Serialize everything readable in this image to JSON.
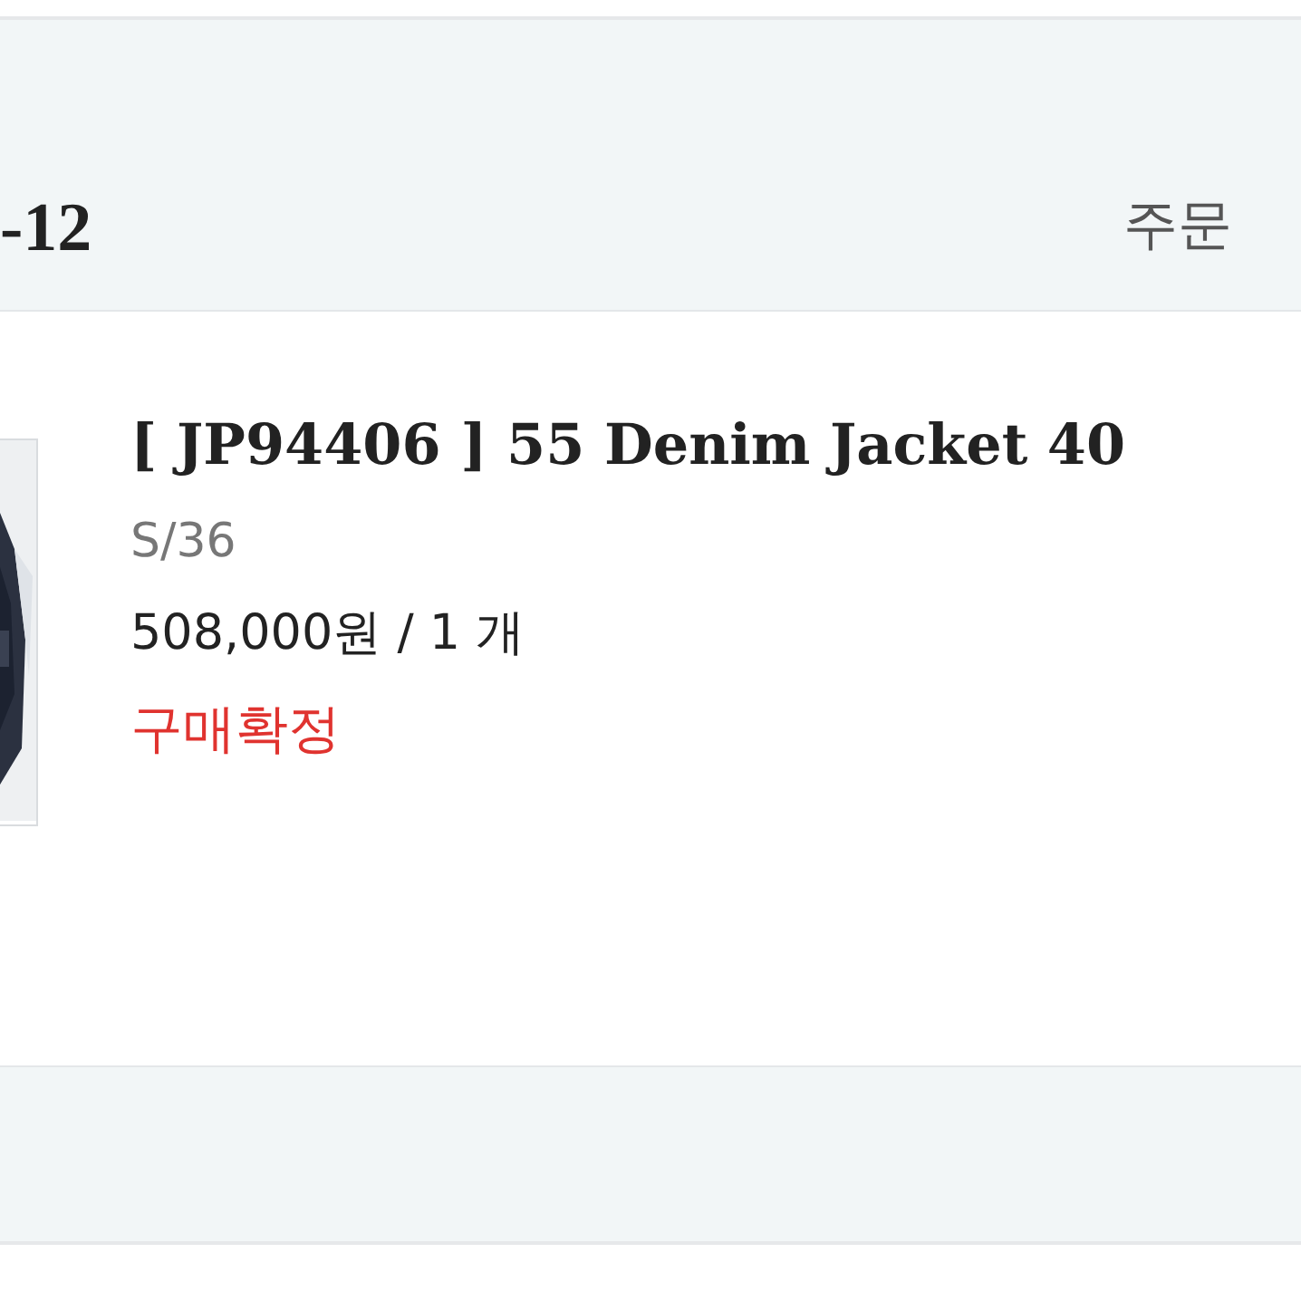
{
  "order_header": {
    "date": "-12",
    "status_link": "주문"
  },
  "item": {
    "title": "[ JP94406 ] 55 Denim Jacket 40",
    "option": "S/36",
    "price": "508,000원 / 1 개",
    "status": "구매확정"
  }
}
